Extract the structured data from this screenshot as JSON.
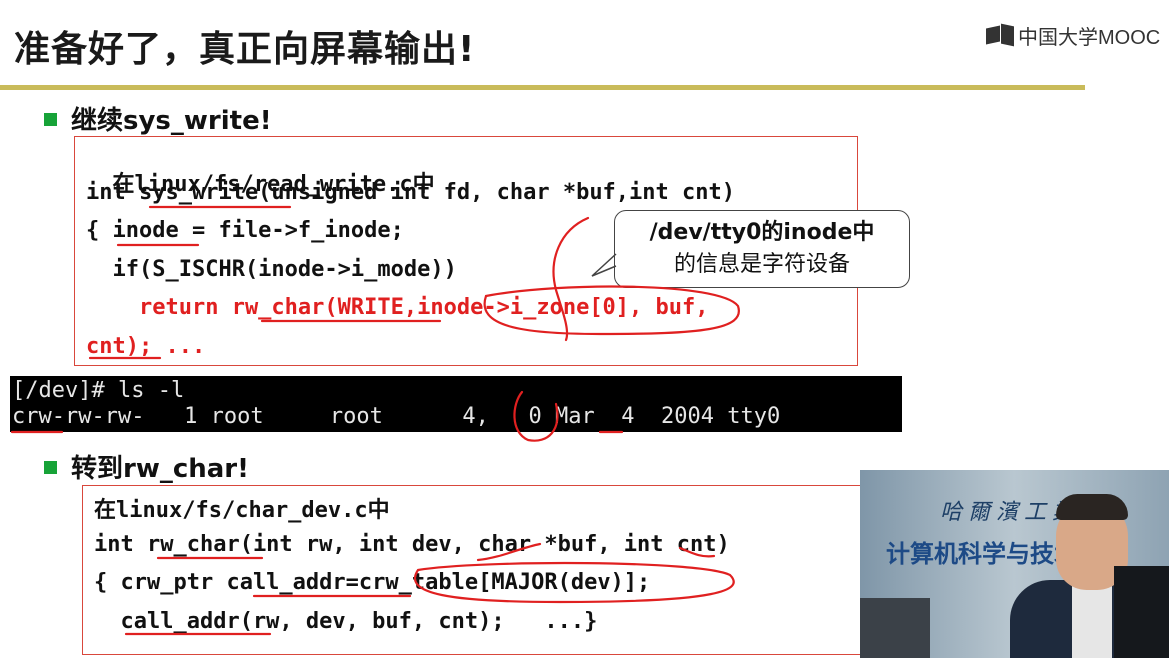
{
  "slide": {
    "title": "准备好了，真正向屏幕输出!",
    "logo_text": "中国大学MOOC",
    "accent_color": "#c9bb5a"
  },
  "section1": {
    "bullet": "继续sys_write!",
    "code": [
      "在linux/fs/read_write.c中",
      "int sys_write(unsigned int fd, char *buf,int cnt)",
      "{ inode = file->f_inode;",
      "  if(S_ISCHR(inode->i_mode))",
      "    return rw_char(WRITE,inode->i_zone[0], buf,",
      "cnt); ..."
    ]
  },
  "callout": {
    "line1": "/dev/tty0的inode中",
    "line2": "的信息是字符设备"
  },
  "terminal": {
    "line1": "[/dev]# ls -l",
    "line2": "crw-rw-rw-   1 root     root      4,   0 Mar  4  2004 tty0"
  },
  "section2": {
    "bullet": "转到rw_char!",
    "code": [
      "在linux/fs/char_dev.c中",
      "int rw_char(int rw, int dev, char *buf, int cnt)",
      "{ crw_ptr call_addr=crw_table[MAJOR(dev)];",
      "  call_addr(rw, dev, buf, cnt);   ...}"
    ]
  },
  "video": {
    "sign_line1": "哈爾濱工業",
    "sign_line2": "计算机科学与技术学院"
  }
}
